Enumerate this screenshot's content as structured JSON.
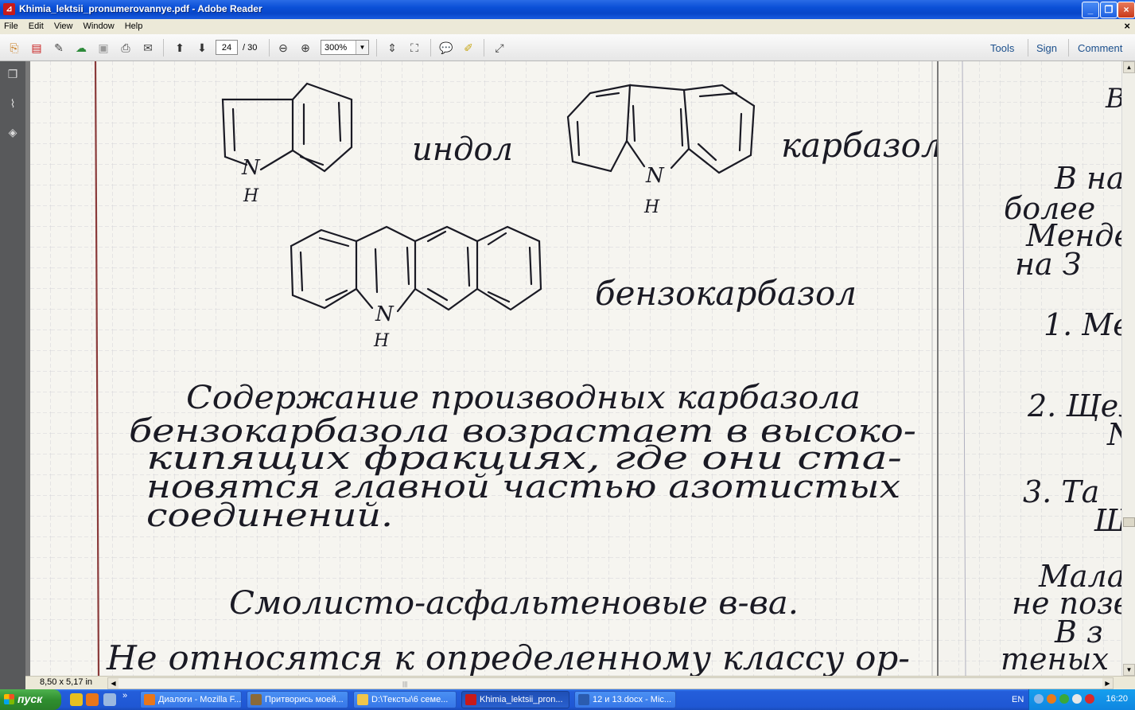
{
  "window": {
    "title": "Khimia_lektsii_pronumerovannye.pdf - Adobe Reader",
    "app_icon": "adobe-reader-icon",
    "controls": [
      "minimize",
      "maximize",
      "close"
    ]
  },
  "menu": {
    "items": [
      "File",
      "Edit",
      "View",
      "Window",
      "Help"
    ],
    "close_glyph": "×"
  },
  "toolbar": {
    "page_current": "24",
    "page_total": "/ 30",
    "zoom": "300%",
    "right_tabs": [
      "Tools",
      "Sign",
      "Comment"
    ]
  },
  "document": {
    "page_size": "8,50 x 5,17 in",
    "labels": {
      "indol": "индол",
      "karbazol": "карбазол",
      "benzokarbazol": "бензокарбазол",
      "atom_n": "N",
      "atom_h": "H"
    },
    "paragraph": [
      "Содержание производных карбазола",
      "бензокарбазола возрастает в высоко-",
      "кипящих фракциях, где они ста-",
      "новятся главной частью азотистых",
      "соединений."
    ],
    "heading": "Смолисто-асфальтеновые в-ва.",
    "last_line": "Не относятся к определенному классу ор-",
    "right_page_lines": [
      "В на",
      "более",
      "Менде",
      "на З",
      "1. Ме",
      "2. Щел",
      "N",
      "3. Та",
      "Ш,",
      "Мала",
      "не позв",
      "В з",
      "теных"
    ]
  },
  "taskbar": {
    "start_label": "пуск",
    "tasks": [
      {
        "label": "Диалоги - Mozilla F...",
        "icon": "firefox-icon",
        "color": "#e8761a"
      },
      {
        "label": "Притворись моей...",
        "icon": "film-icon",
        "color": "#8a6a3a"
      },
      {
        "label": "D:\\Тексты\\6 семе...",
        "icon": "folder-icon",
        "color": "#f0c64a"
      },
      {
        "label": "Khimia_lektsii_pron...",
        "icon": "adobe-reader-icon",
        "color": "#c81a1a",
        "active": true
      },
      {
        "label": "12 и 13.docx - Mic...",
        "icon": "word-icon",
        "color": "#2b5caf"
      }
    ],
    "language": "EN",
    "clock": "16:20"
  }
}
